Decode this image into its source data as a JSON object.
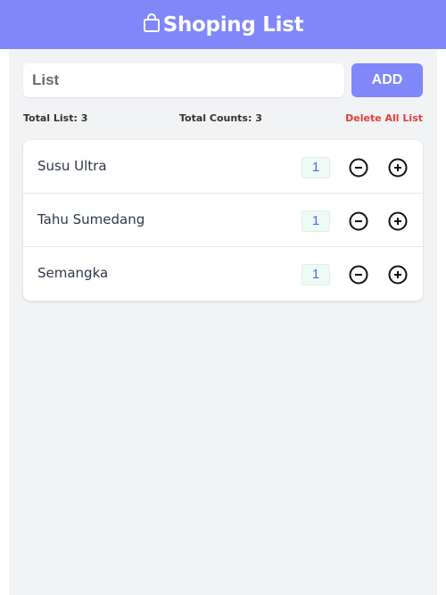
{
  "header": {
    "title": "Shoping List",
    "icon": "shopping-bag-icon",
    "background": "#8087f9"
  },
  "form": {
    "input_placeholder": "List",
    "input_value": "",
    "add_label": "ADD"
  },
  "stats": {
    "total_list": "Total List: 3",
    "total_counts": "Total Counts: 3",
    "delete_all": "Delete All List",
    "delete_color": "#e53e3e"
  },
  "items": [
    {
      "name": "Susu Ultra",
      "qty": "1"
    },
    {
      "name": "Tahu Sumedang",
      "qty": "1"
    },
    {
      "name": "Semangka",
      "qty": "1"
    }
  ],
  "icons": {
    "decrement": "minus-circle-icon",
    "increment": "plus-circle-icon"
  }
}
